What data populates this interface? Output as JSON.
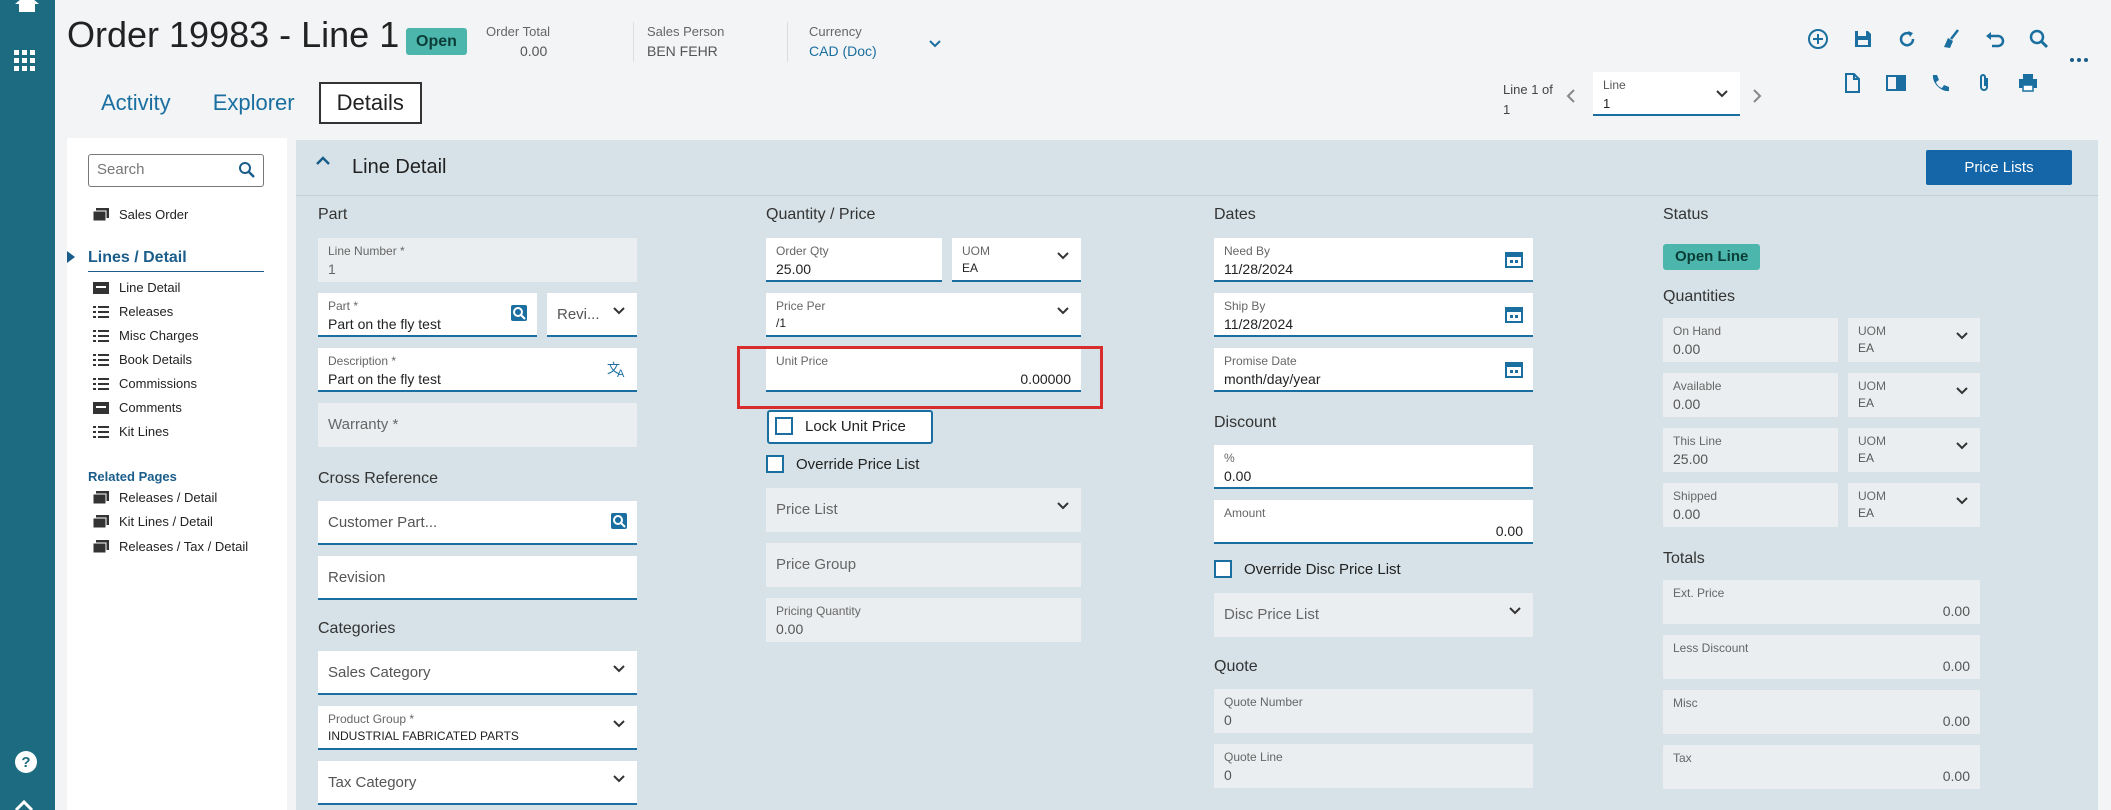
{
  "header": {
    "title": "Order 19983 - Line 1",
    "status": "Open",
    "order_total_label": "Order Total",
    "order_total_value": "0.00",
    "sales_person_label": "Sales Person",
    "sales_person_value": "BEN FEHR",
    "currency_label": "Currency",
    "currency_value": "CAD (Doc)"
  },
  "tabs": [
    {
      "label": "Activity"
    },
    {
      "label": "Explorer"
    },
    {
      "label": "Details"
    }
  ],
  "line_nav": {
    "line_of_1": "Line 1 of",
    "line_of_2": "1",
    "line_label": "Line",
    "line_value": "1"
  },
  "leftnav": {
    "search_placeholder": "Search",
    "sales_order": "Sales Order",
    "lines_detail": "Lines / Detail",
    "items": [
      "Line Detail",
      "Releases",
      "Misc Charges",
      "Book Details",
      "Commissions",
      "Comments",
      "Kit Lines"
    ],
    "related_title": "Related Pages",
    "related": [
      "Releases / Detail",
      "Kit Lines / Detail",
      "Releases / Tax / Detail"
    ]
  },
  "main": {
    "title": "Line Detail",
    "price_lists_button": "Price Lists",
    "part": {
      "section": "Part",
      "line_number_label": "Line Number *",
      "line_number_value": "1",
      "part_label": "Part *",
      "part_value": "Part on the fly test",
      "revision_short": "Revi...",
      "description_label": "Description *",
      "description_value": "Part on the fly test",
      "warranty": "Warranty *"
    },
    "cross_ref": {
      "section": "Cross Reference",
      "customer_part": "Customer Part...",
      "revision": "Revision"
    },
    "categories": {
      "section": "Categories",
      "sales_category": "Sales Category",
      "product_group_label": "Product Group *",
      "product_group_value": "INDUSTRIAL FABRICATED PARTS",
      "tax_category": "Tax Category"
    },
    "qty_price": {
      "section": "Quantity / Price",
      "order_qty_label": "Order Qty",
      "order_qty_value": "25.00",
      "uom_label": "UOM",
      "uom_value": "EA",
      "price_per_label": "Price Per",
      "price_per_value": "/1",
      "unit_price_label": "Unit Price",
      "unit_price_value": "0.00000",
      "lock_unit_price": "Lock Unit Price",
      "override_price_list": "Override Price List",
      "price_list": "Price List",
      "price_group": "Price Group",
      "pricing_qty_label": "Pricing Quantity",
      "pricing_qty_value": "0.00"
    },
    "dates": {
      "section": "Dates",
      "need_by_label": "Need By",
      "need_by_value": "11/28/2024",
      "ship_by_label": "Ship By",
      "ship_by_value": "11/28/2024",
      "promise_label": "Promise Date",
      "promise_value": "month/day/year"
    },
    "discount": {
      "section": "Discount",
      "pct_label": "%",
      "pct_value": "0.00",
      "amount_label": "Amount",
      "amount_value": "0.00",
      "override_disc": "Override Disc Price List",
      "disc_price_list": "Disc Price List"
    },
    "quote": {
      "section": "Quote",
      "quote_number_label": "Quote Number",
      "quote_number_value": "0",
      "quote_line_label": "Quote Line",
      "quote_line_value": "0"
    },
    "status": {
      "section": "Status",
      "badge": "Open Line",
      "quantities": "Quantities",
      "rows": [
        {
          "label": "On Hand",
          "value": "0.00",
          "uom_label": "UOM",
          "uom_value": "EA"
        },
        {
          "label": "Available",
          "value": "0.00",
          "uom_label": "UOM",
          "uom_value": "EA"
        },
        {
          "label": "This Line",
          "value": "25.00",
          "uom_label": "UOM",
          "uom_value": "EA"
        },
        {
          "label": "Shipped",
          "value": "0.00",
          "uom_label": "UOM",
          "uom_value": "EA"
        }
      ],
      "totals": "Totals",
      "totals_rows": [
        {
          "label": "Ext. Price",
          "value": "0.00"
        },
        {
          "label": "Less Discount",
          "value": "0.00"
        },
        {
          "label": "Misc",
          "value": "0.00"
        },
        {
          "label": "Tax",
          "value": "0.00"
        }
      ]
    }
  },
  "colors": {
    "rail": "#1d6b80",
    "accent": "#1a6fa0",
    "status_green": "#4db6ac",
    "highlight_red": "#d92d2d"
  }
}
